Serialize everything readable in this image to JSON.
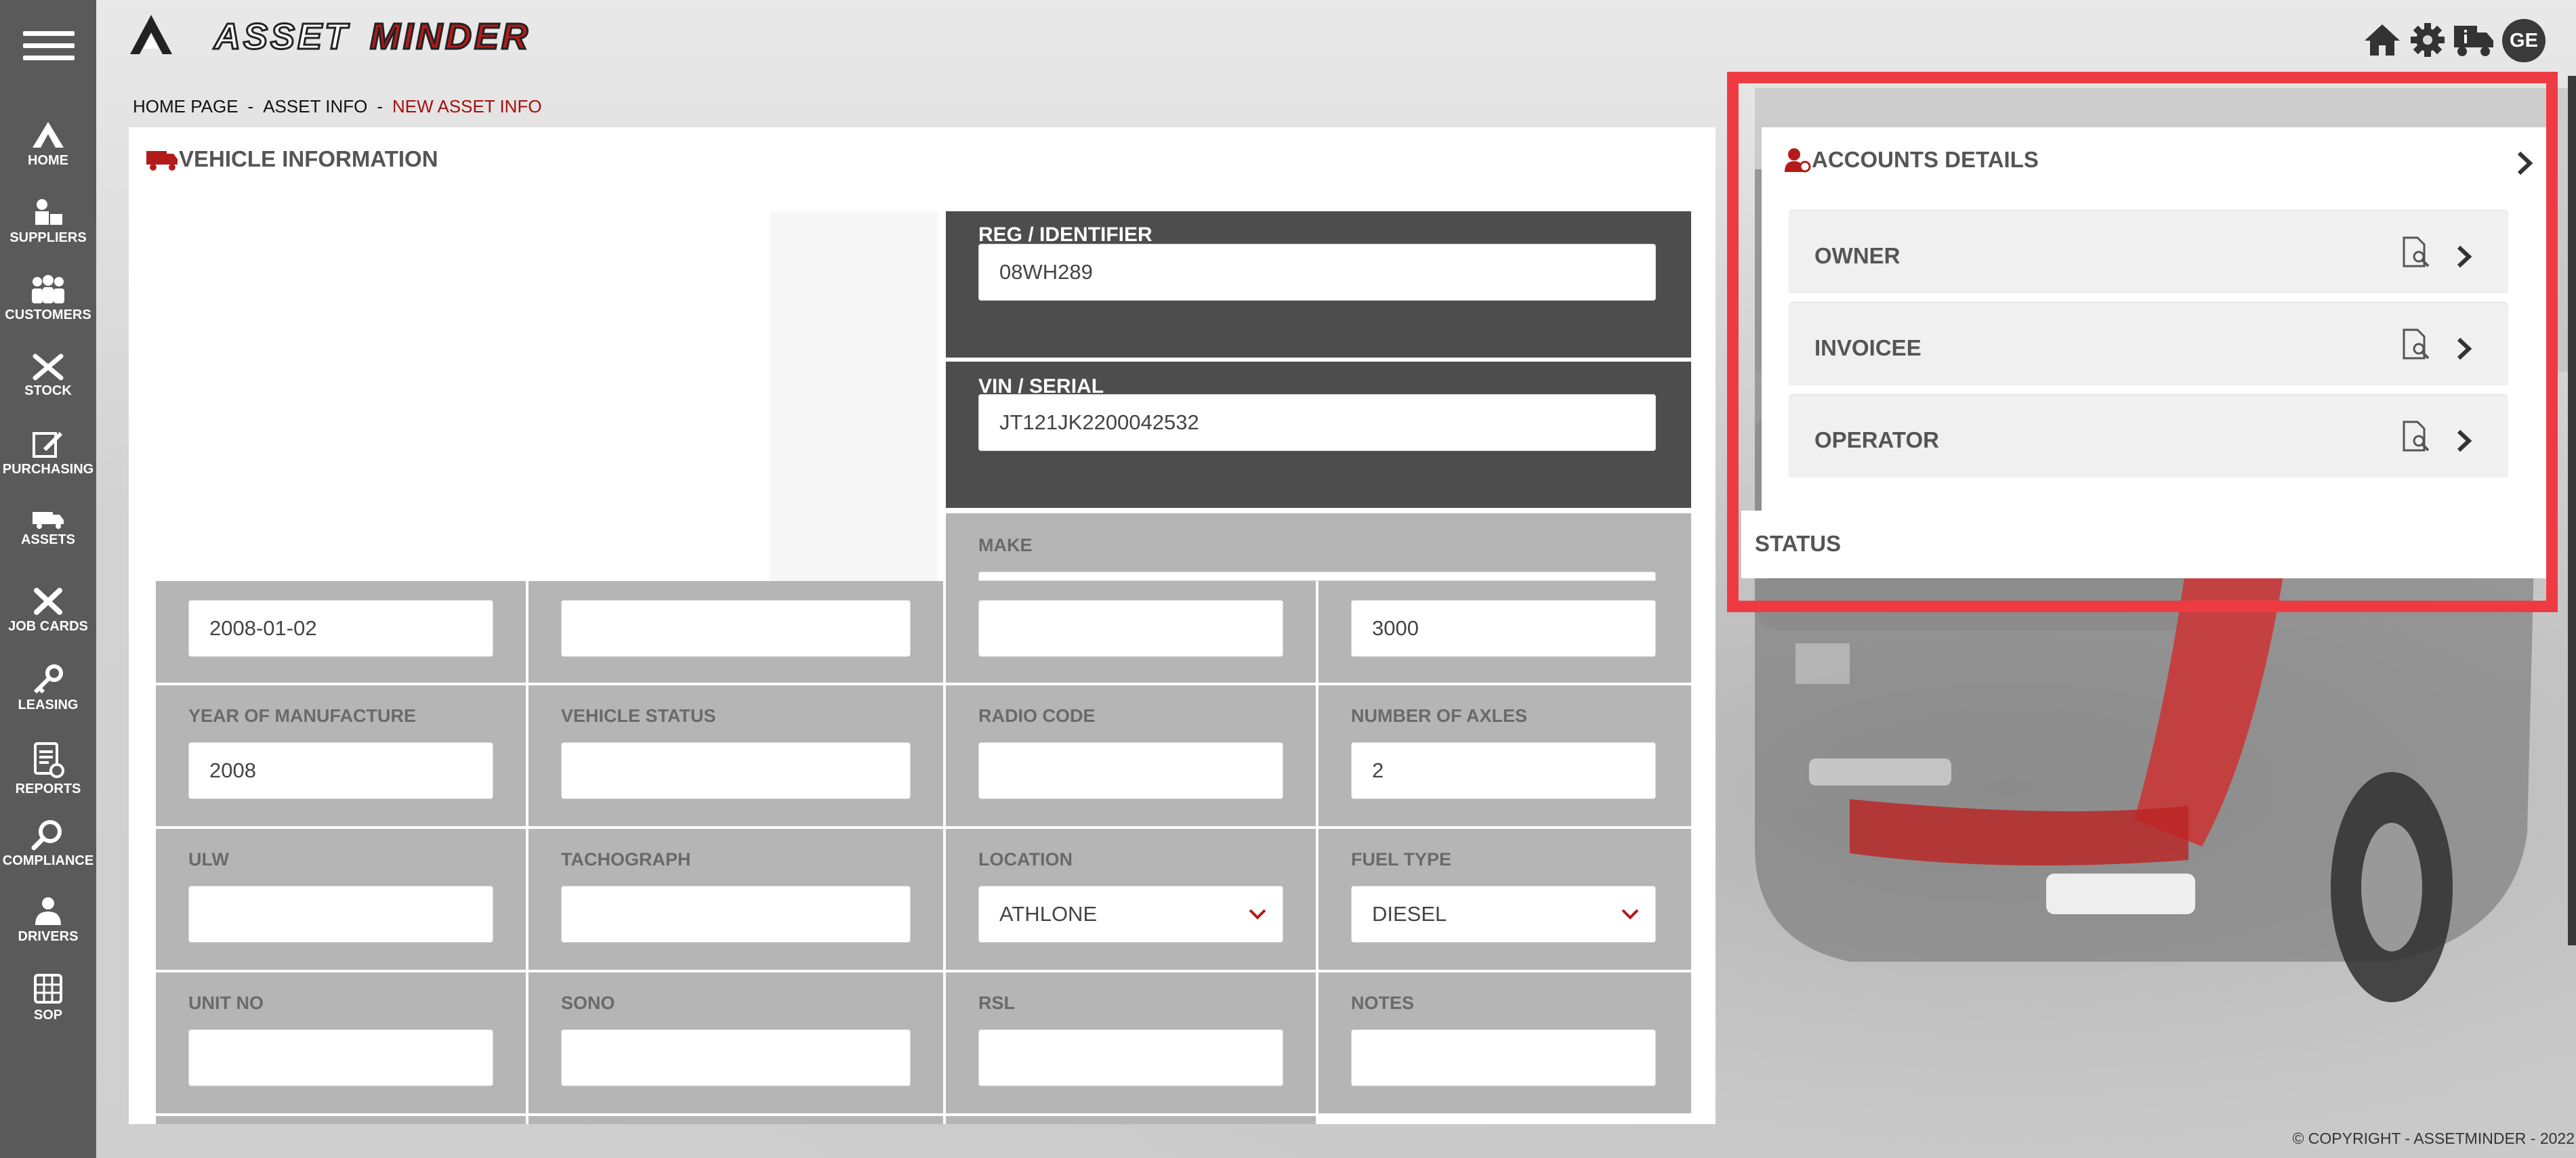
{
  "app": {
    "brand": "ASSETMINDER",
    "user_initials": "GE",
    "colors": {
      "sidebar": "#5a5a5a",
      "accent": "#a40f0f",
      "highlight": "#ee3b42",
      "dark_block": "#4d4d4d",
      "grey_block": "#b5b5b5"
    }
  },
  "header": {
    "icons": [
      "home-icon",
      "gear-icon",
      "truck-info-icon"
    ]
  },
  "sidebar": {
    "items": [
      {
        "label": "HOME",
        "icon": "home-icon"
      },
      {
        "label": "SUPPLIERS",
        "icon": "suppliers-icon"
      },
      {
        "label": "CUSTOMERS",
        "icon": "customers-icon"
      },
      {
        "label": "STOCK",
        "icon": "stock-icon"
      },
      {
        "label": "PURCHASING",
        "icon": "purchasing-icon"
      },
      {
        "label": "ASSETS",
        "icon": "truck-icon"
      },
      {
        "label": "JOB CARDS",
        "icon": "tools-icon"
      },
      {
        "label": "LEASING",
        "icon": "key-icon"
      },
      {
        "label": "REPORTS",
        "icon": "reports-icon"
      },
      {
        "label": "COMPLIANCE",
        "icon": "compliance-icon"
      },
      {
        "label": "DRIVERS",
        "icon": "driver-icon"
      },
      {
        "label": "SOP",
        "icon": "sop-icon"
      }
    ]
  },
  "breadcrumb": {
    "home": "HOME PAGE",
    "asset_info": "ASSET INFO",
    "current": "NEW ASSET INFO",
    "separator": "-"
  },
  "vehicle": {
    "title": "VEHICLE INFORMATION",
    "reg": {
      "label": "REG / IDENTIFIER",
      "value": "08WH289"
    },
    "vin": {
      "label": "VIN / SERIAL",
      "value": "JT121JK2200042532"
    },
    "make": {
      "label": "MAKE",
      "value": ""
    },
    "row1": [
      "2008-01-02",
      "",
      "",
      "3000"
    ],
    "fields": [
      {
        "label": "YEAR OF MANUFACTURE",
        "value": "2008"
      },
      {
        "label": "VEHICLE STATUS",
        "value": ""
      },
      {
        "label": "RADIO CODE",
        "value": ""
      },
      {
        "label": "NUMBER OF AXLES",
        "value": "2"
      },
      {
        "label": "ULW",
        "value": ""
      },
      {
        "label": "TACHOGRAPH",
        "value": ""
      },
      {
        "label": "LOCATION",
        "value": "ATHLONE"
      },
      {
        "label": "FUEL TYPE",
        "value": "DIESEL"
      },
      {
        "label": "UNIT NO",
        "value": ""
      },
      {
        "label": "SONO",
        "value": ""
      },
      {
        "label": "RSL",
        "value": ""
      },
      {
        "label": "NOTES",
        "value": ""
      }
    ]
  },
  "accounts": {
    "title": "ACCOUNTS DETAILS",
    "rows": [
      {
        "label": "OWNER"
      },
      {
        "label": "INVOICEE"
      },
      {
        "label": "OPERATOR"
      }
    ],
    "status_label": "STATUS"
  },
  "footer": {
    "copyright": "© COPYRIGHT - ASSETMINDER - 2022"
  }
}
